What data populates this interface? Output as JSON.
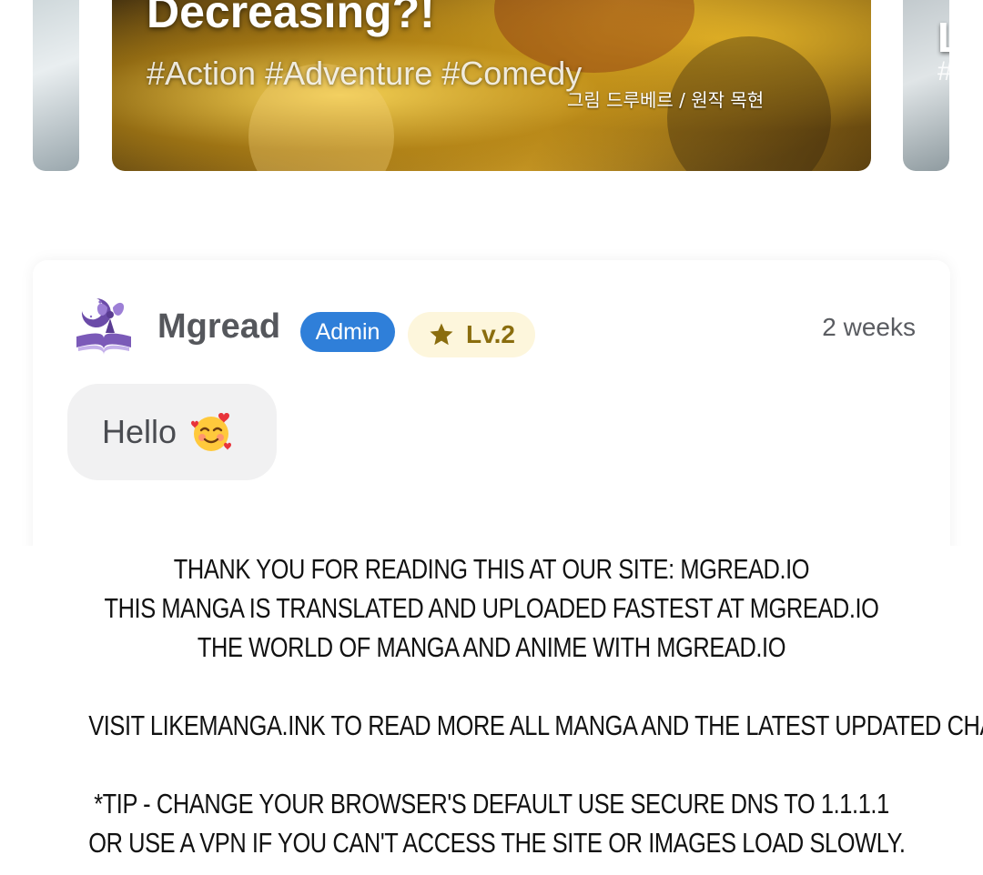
{
  "carousel": {
    "left_card": {},
    "main_card": {
      "title": "Decreasing?!",
      "tags": "#Action #Adventure #Comedy",
      "korean_credit": "그림 드루베르 / 원작 목현"
    },
    "right_card": {
      "partial_title": "L",
      "partial_tag": "#"
    }
  },
  "comment": {
    "username": "Mgread",
    "role_badge": "Admin",
    "level": "Lv.2",
    "time": "2 weeks",
    "message": "Hello",
    "emoji": "smiling-face-with-hearts-icon",
    "colors": {
      "admin_badge": "#2f7fd9",
      "level_badge_bg": "#fdf6dc",
      "level_text": "#8a6d0e",
      "bubble_bg": "#f1f1f2"
    }
  },
  "notice": {
    "line1": "Thank you for reading this at our site: mgread.io",
    "line2": "This manga is translated and uploaded fastest at mgread.io",
    "line3": "The world of manga and anime with mgread.io",
    "line4": "Visit likemanga.ink to read more all manga and the latest updated chapters.",
    "line5": "*Tip - Change your browser's default use secure DNS to 1.1.1.1",
    "line6": "or use a VPN if you can't access the site or images load slowly."
  }
}
